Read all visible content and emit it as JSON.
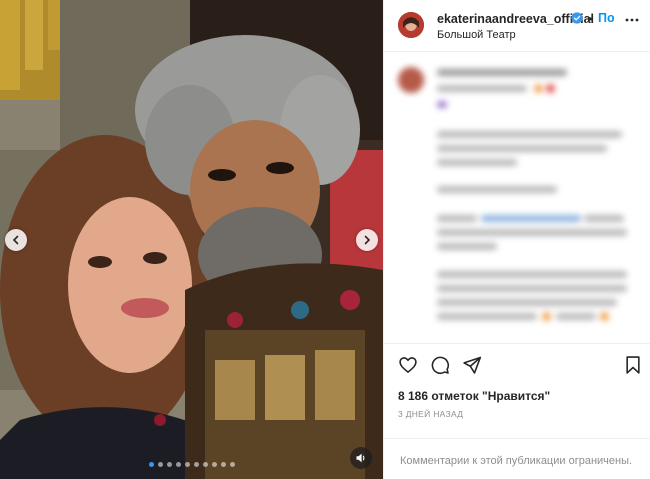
{
  "post": {
    "username": "ekaterinaandreeva_official",
    "separator": "•",
    "follow_label": "По",
    "location": "Большой Театр",
    "likes_text": "8 186 отметок \"Нравится\"",
    "date_text": "3 ДНЕЙ НАЗАД",
    "comments_disabled_text": "Комментарии к этой публикации ограничены."
  },
  "carousel": {
    "slide_count": 10,
    "active_index": 0
  },
  "colors": {
    "accent": "#0095f6",
    "verified": "#3897f0",
    "text": "#262626",
    "muted": "#8e8e8e"
  },
  "icons": {
    "avatar": "avatar",
    "verified": "verified-badge-icon",
    "more": "more-options-icon",
    "like": "heart-icon",
    "comment": "comment-icon",
    "share": "share-icon",
    "save": "bookmark-icon",
    "prev": "chevron-left-icon",
    "next": "chevron-right-icon",
    "sound": "sound-icon"
  }
}
